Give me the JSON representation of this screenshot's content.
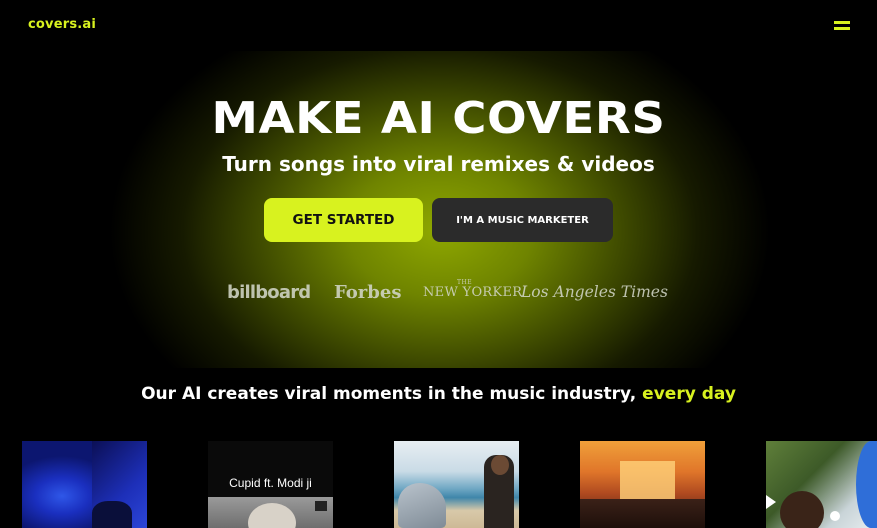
{
  "header": {
    "logo": "covers.ai",
    "menu_icon": "hamburger-icon"
  },
  "hero": {
    "title": "MAKE AI COVERS",
    "subtitle": "Turn songs into viral remixes & videos",
    "primary_button": "GET STARTED",
    "secondary_button": "I'M A MUSIC MARKETER",
    "press": {
      "billboard": "billboard",
      "forbes": "Forbes",
      "newyorker_the": "THE",
      "newyorker_name": "NEW YORKER",
      "lat": "Los Angeles Times"
    }
  },
  "tagline": {
    "text": "Our AI creates viral moments in the music industry, ",
    "accent": "every day"
  },
  "videos": [
    {
      "caption": ""
    },
    {
      "caption": "Cupid ft. Modi ji"
    },
    {
      "caption": ""
    },
    {
      "caption": ""
    },
    {
      "caption": ""
    }
  ],
  "colors": {
    "accent": "#d8f21f",
    "background": "#000000",
    "secondary_button": "#2b2b2b"
  }
}
